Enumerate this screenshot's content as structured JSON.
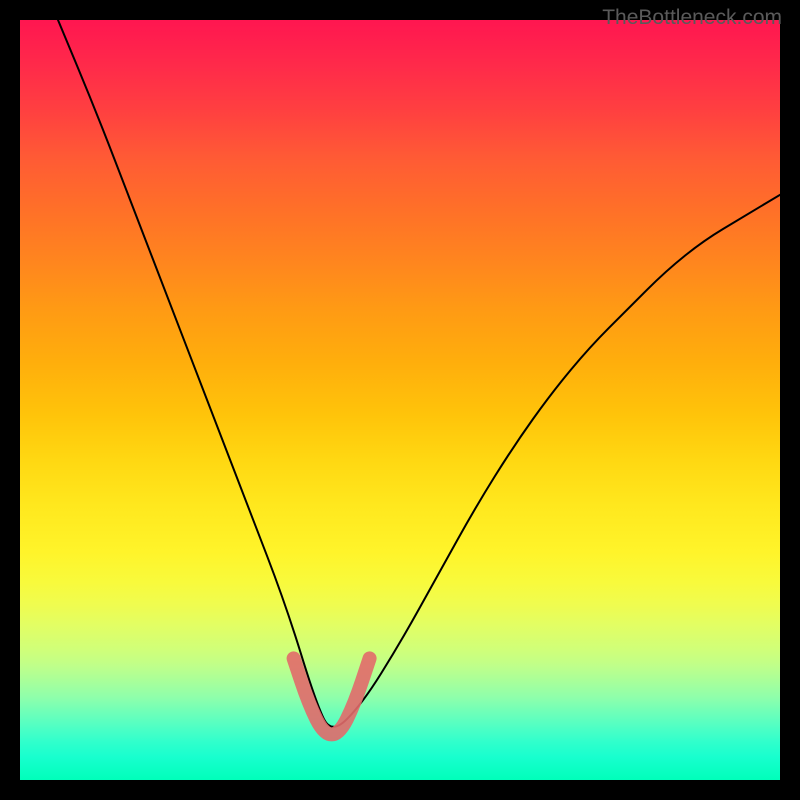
{
  "watermark": "TheBottleneck.com",
  "chart_data": {
    "type": "line",
    "title": "",
    "xlabel": "",
    "ylabel": "",
    "xlim": [
      0,
      100
    ],
    "ylim": [
      0,
      100
    ],
    "background_gradient": {
      "top_color": "#ff1650",
      "mid_color": "#ffe81e",
      "bottom_color": "#00ffba",
      "direction": "vertical",
      "meaning": "red high / green low"
    },
    "series": [
      {
        "name": "curve",
        "description": "V-shaped bottleneck curve, minimum near x≈41",
        "color": "#000000",
        "x": [
          5,
          10,
          15,
          20,
          25,
          30,
          35,
          39,
          41,
          45,
          50,
          55,
          60,
          65,
          70,
          75,
          80,
          85,
          90,
          95,
          100
        ],
        "values": [
          100,
          88,
          75,
          62,
          49,
          36,
          23,
          10,
          6,
          10,
          18,
          27,
          36,
          44,
          51,
          57,
          62,
          67,
          71,
          74,
          77
        ]
      },
      {
        "name": "highlighted-minimum",
        "description": "Thick semi-transparent red/salmon overlay around the curve minimum",
        "color": "#e26a6a",
        "x": [
          36,
          38,
          40,
          42,
          44,
          46
        ],
        "values": [
          16,
          10,
          6,
          6,
          10,
          16
        ]
      }
    ]
  }
}
